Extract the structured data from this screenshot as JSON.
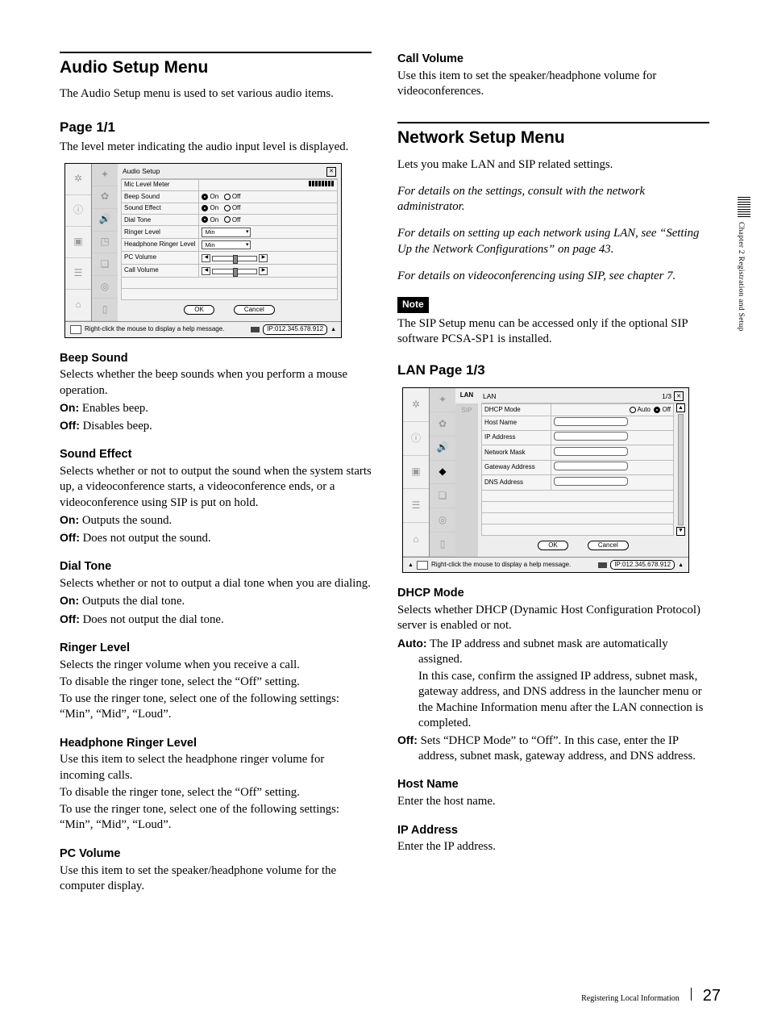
{
  "side": {
    "chapter": "Chapter 2  Registration and Setup"
  },
  "footer": {
    "title": "Registering Local Information",
    "page": "27"
  },
  "audio": {
    "heading": "Audio Setup Menu",
    "intro": "The Audio Setup menu is used to set various audio items.",
    "pageH": "Page 1/1",
    "pageT": "The level meter indicating the audio input level is displayed.",
    "shot": {
      "title": "Audio Setup",
      "rows": {
        "mic": "Mic Level Meter",
        "beep": "Beep Sound",
        "se": "Sound Effect",
        "dial": "Dial Tone",
        "ringer": "Ringer Level",
        "hpRinger": "Headphone Ringer Level",
        "pcVol": "PC Volume",
        "callVol": "Call Volume"
      },
      "on": "On",
      "off": "Off",
      "min": "Min",
      "ok": "OK",
      "cancel": "Cancel",
      "status": "Right-click the mouse to display a help message.",
      "ip": "IP:012.345.678.912"
    },
    "beep": {
      "h": "Beep Sound",
      "t": "Selects whether the beep sounds when you perform a mouse operation.",
      "on": "Enables beep.",
      "off": "Disables beep."
    },
    "se": {
      "h": "Sound Effect",
      "t": "Selects whether or not to output the sound when the system starts up, a videoconference starts, a videoconference ends, or a videoconference using SIP is put on hold.",
      "on": "Outputs the sound.",
      "off": "Does not output the sound."
    },
    "dial": {
      "h": "Dial Tone",
      "t": "Selects whether or not to output a dial tone when you are dialing.",
      "on": "Outputs the dial tone.",
      "off": "Does not output the dial tone."
    },
    "ringer": {
      "h": "Ringer Level",
      "l1": "Selects the ringer volume when you receive a call.",
      "l2": "To disable the ringer tone, select the “Off” setting.",
      "l3": "To use the ringer tone, select one of the following settings: “Min”, “Mid”, “Loud”."
    },
    "hpRinger": {
      "h": "Headphone Ringer Level",
      "l1": "Use this item to select the headphone ringer volume for incoming calls.",
      "l2": "To disable the ringer tone, select the “Off” setting.",
      "l3": "To use the ringer tone, select one of the following settings: “Min”, “Mid”, “Loud”."
    },
    "pcVol": {
      "h": "PC Volume",
      "t": "Use this item to set the speaker/headphone volume for the computer display."
    },
    "callVol": {
      "h": "Call Volume",
      "t": "Use this item to set the speaker/headphone volume for videoconferences."
    },
    "onLead": "On:",
    "offLead": "Off:"
  },
  "net": {
    "heading": "Network Setup Menu",
    "intro": "Lets you make LAN and SIP related settings.",
    "i1": "For details on the settings, consult with the network administrator.",
    "i2": "For details on setting up each network using LAN, see “Setting Up the Network Configurations” on page 43.",
    "i3": "For details on videoconferencing using SIP, see chapter 7.",
    "noteLabel": "Note",
    "note": "The SIP Setup menu can be accessed only if the optional SIP software PCSA-SP1 is installed.",
    "lanH": "LAN Page 1/3",
    "shot": {
      "tab1": "LAN",
      "tab2": "SIP",
      "title": "LAN",
      "pg": "1/3",
      "rows": {
        "dhcp": "DHCP Mode",
        "auto": "Auto",
        "off": "Off",
        "host": "Host Name",
        "ip": "IP Address",
        "mask": "Network Mask",
        "gw": "Gateway Address",
        "dns": "DNS Address"
      },
      "ok": "OK",
      "cancel": "Cancel",
      "status": "Right-click the mouse to display a help message.",
      "ip": "IP:012.345.678.912"
    },
    "dhcp": {
      "h": "DHCP Mode",
      "t": "Selects whether DHCP (Dynamic Host Configuration Protocol) server is enabled or not.",
      "autoLead": "Auto:",
      "auto1": "The IP address and subnet mask are automatically assigned.",
      "auto2": "In this case, confirm the assigned IP address, subnet mask, gateway address, and DNS address in the launcher menu or the Machine Information menu after the LAN connection is completed.",
      "offLead": "Off:",
      "off": "Sets “DHCP Mode” to “Off”. In this case, enter the IP address, subnet mask, gateway address, and DNS address."
    },
    "host": {
      "h": "Host Name",
      "t": "Enter the host name."
    },
    "ipaddr": {
      "h": "IP Address",
      "t": "Enter the IP address."
    }
  }
}
